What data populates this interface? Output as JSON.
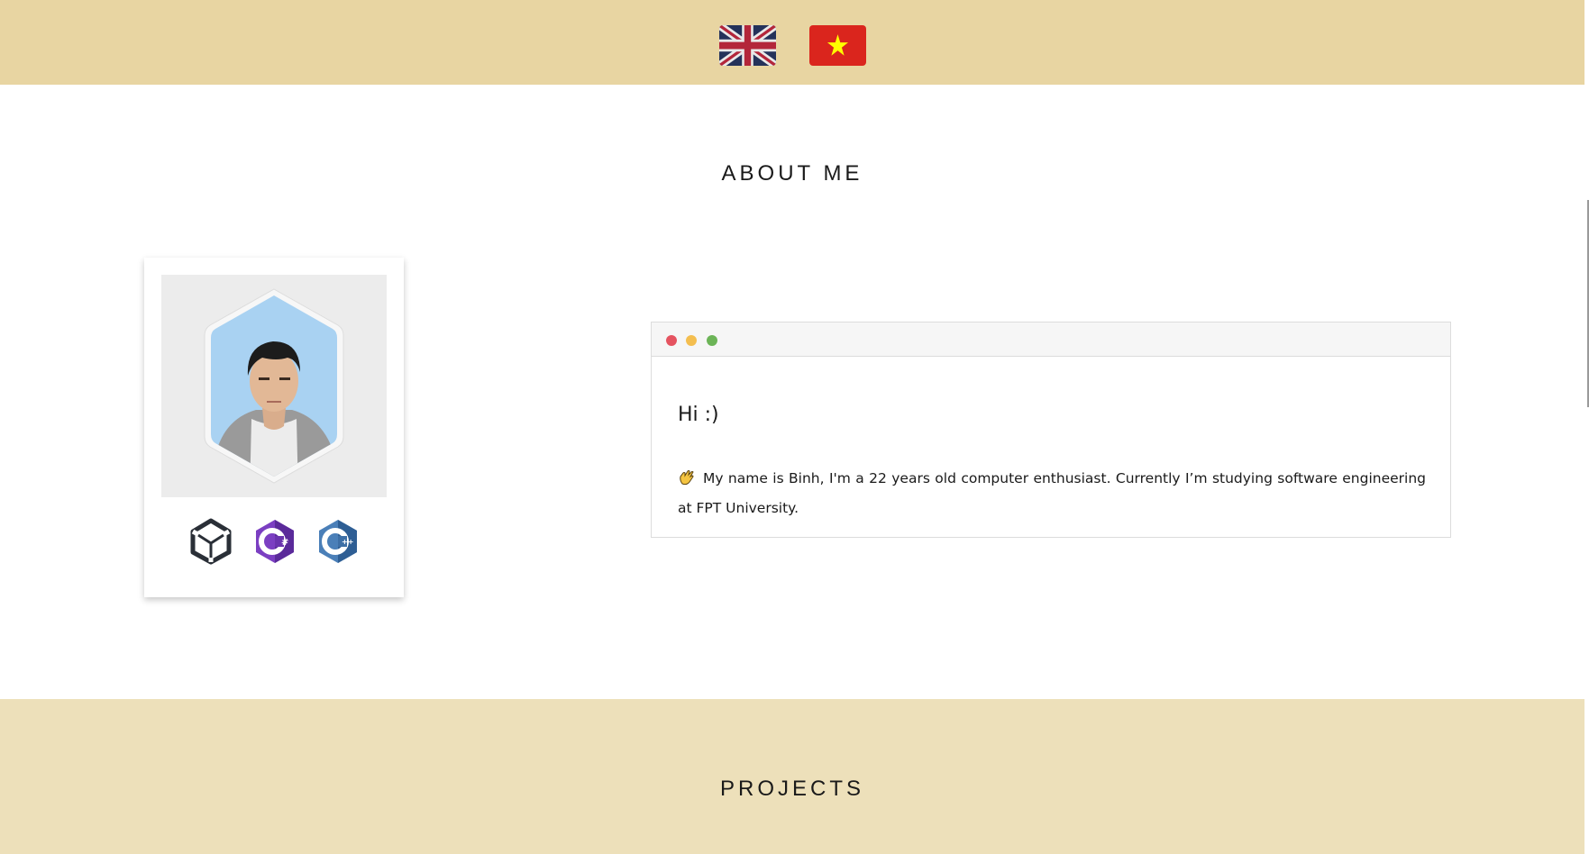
{
  "header": {
    "languages": [
      {
        "name": "English",
        "icon": "uk-flag-icon"
      },
      {
        "name": "Vietnamese",
        "icon": "vietnam-flag-icon"
      }
    ]
  },
  "about": {
    "title": "ABOUT ME",
    "skills": [
      "unity-icon",
      "csharp-icon",
      "cpp-icon"
    ],
    "window": {
      "greeting": "Hi :)",
      "bio": "My name is Binh, I'm a 22 years old computer enthusiast. Currently I’m studying software engineering at FPT University."
    }
  },
  "projects": {
    "title": "PROJECTS"
  },
  "colors": {
    "header_bg": "#e8d5a2",
    "projects_bg": "#ede0ba",
    "dot_red": "#e55360",
    "dot_yellow": "#f4be4f",
    "dot_green": "#6cb457"
  }
}
